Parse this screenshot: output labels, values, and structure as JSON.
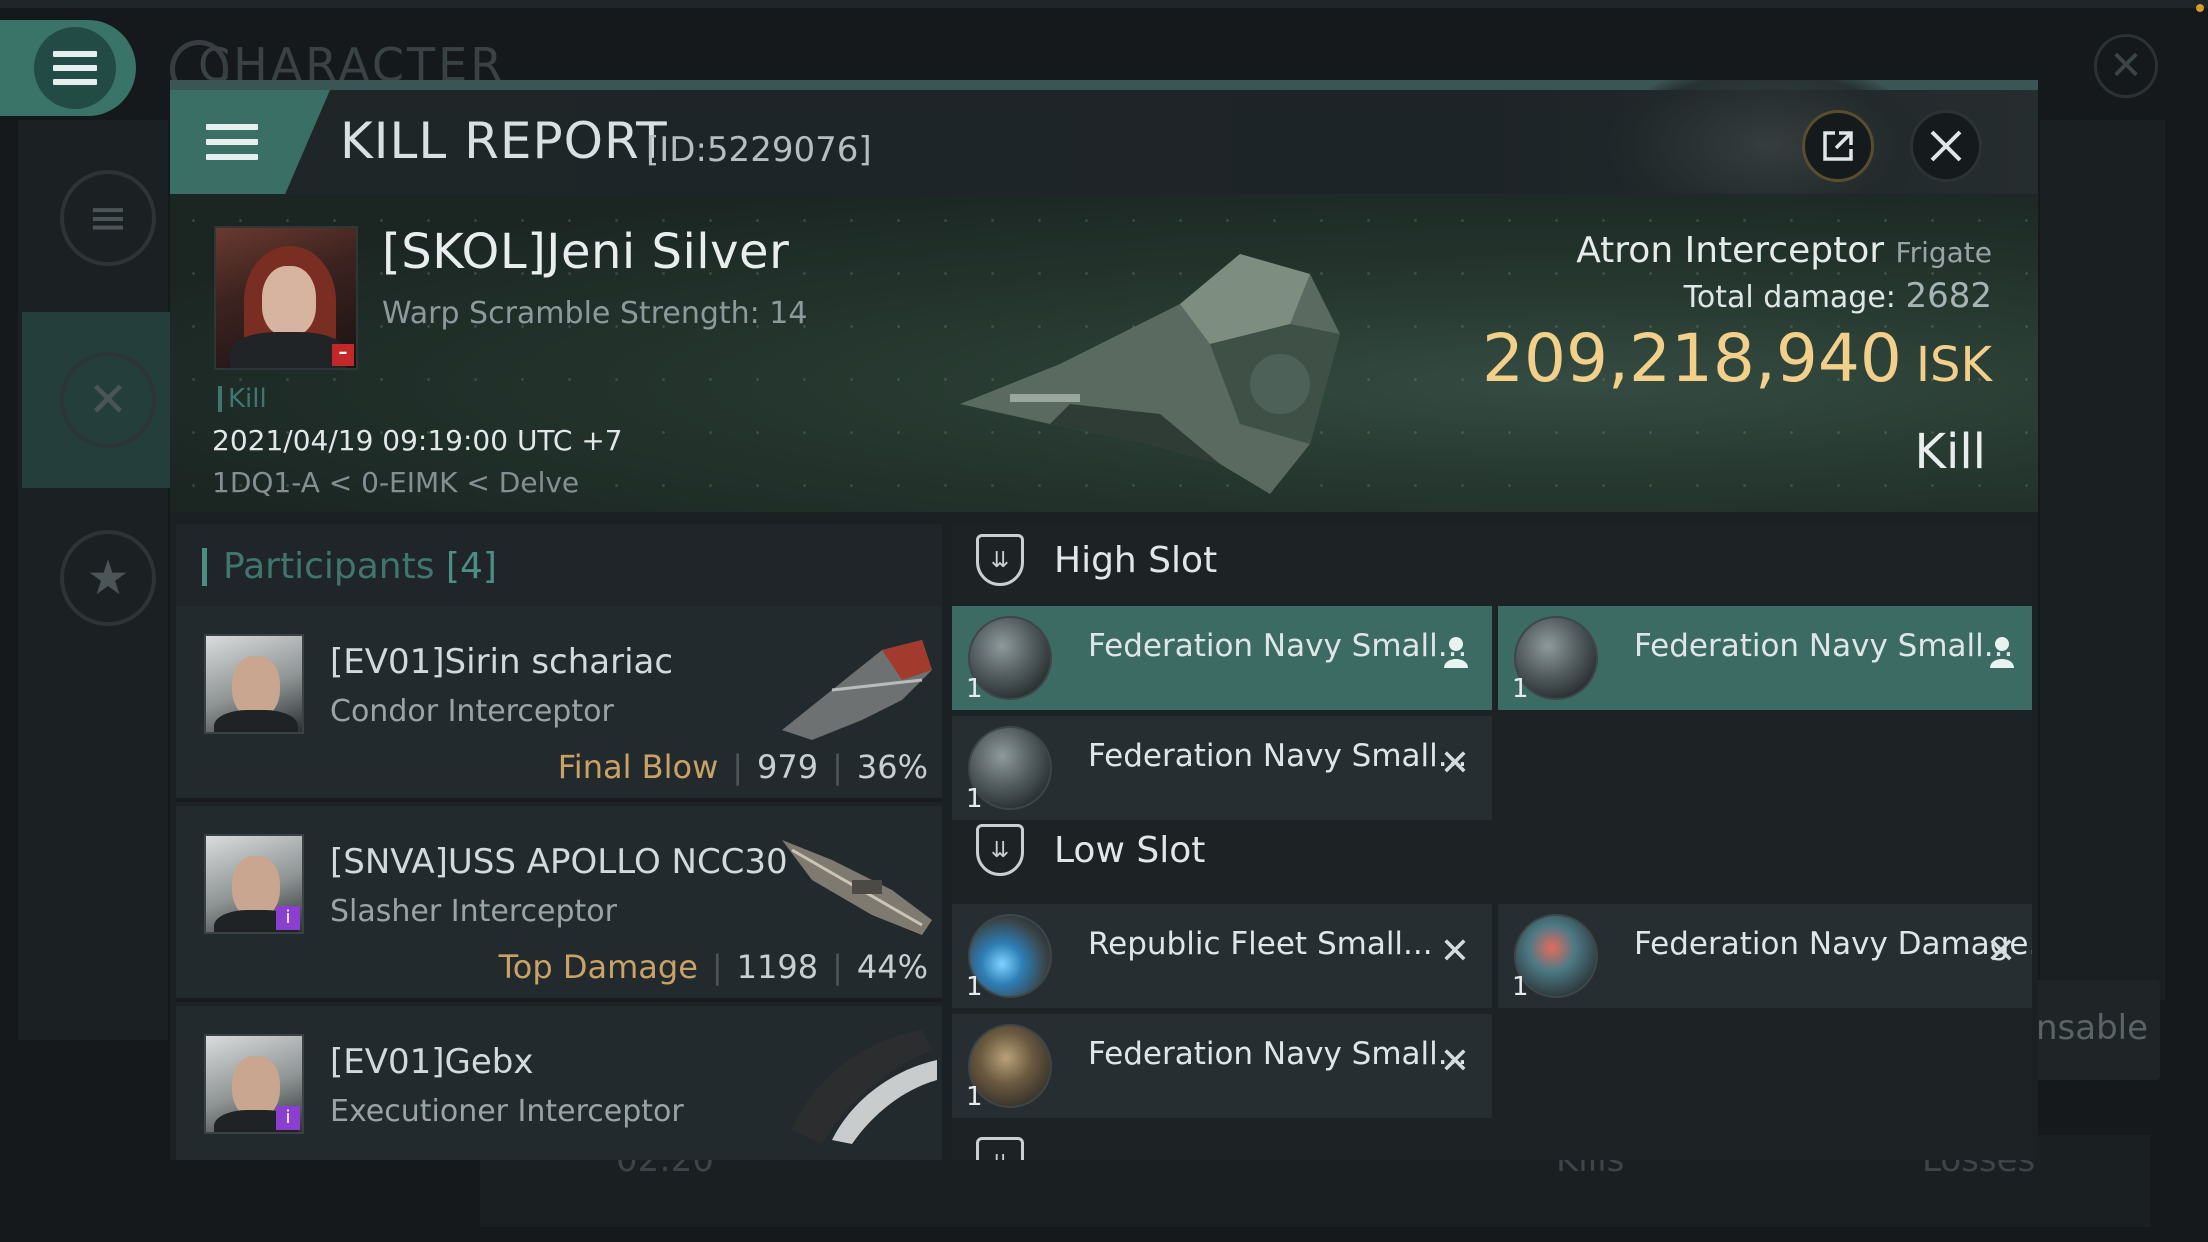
{
  "background": {
    "title": "CHARACTER",
    "bottom_left_value": "02:20",
    "bottom_kills": "Kills",
    "bottom_losses": "Losses",
    "right_button_partial": "nsable"
  },
  "header": {
    "title": "KILL REPORT",
    "id": "[ID:5229076]"
  },
  "victim": {
    "name": "[SKOL]Jeni Silver",
    "subtitle": "Warp Scramble Strength: 14",
    "tag": "Kill",
    "datetime": "2021/04/19 09:19:00 UTC +7",
    "location": "1DQ1-A < 0-EIMK < Delve",
    "ship": "Atron Interceptor",
    "ship_class": "Frigate",
    "total_damage_label": "Total damage:",
    "total_damage": "2682",
    "isk_value": "209,218,940",
    "isk_unit": "ISK",
    "result": "Kill"
  },
  "participants": {
    "title": "Participants",
    "count": "[4]",
    "rows": [
      {
        "name": "[EV01]Sirin schariac",
        "ship": "Condor Interceptor",
        "tag": "Final Blow",
        "damage": "979",
        "percent": "36%"
      },
      {
        "name": "[SNVA]USS APOLLO NCC30",
        "ship": "Slasher Interceptor",
        "tag": "Top Damage",
        "damage": "1198",
        "percent": "44%"
      },
      {
        "name": "[EV01]Gebx",
        "ship": "Executioner Interceptor",
        "tag": "",
        "damage": "",
        "percent": ""
      }
    ]
  },
  "fitting": {
    "high_slot": {
      "label": "High Slot",
      "modules": [
        {
          "name": "Federation Navy Small...",
          "qty": "1",
          "status": "dropped"
        },
        {
          "name": "Federation Navy Small...",
          "qty": "1",
          "status": "dropped"
        },
        {
          "name": "Federation Navy Small...",
          "qty": "1",
          "status": "destroyed"
        }
      ]
    },
    "low_slot": {
      "label": "Low Slot",
      "modules": [
        {
          "name": "Republic Fleet Small...",
          "qty": "1",
          "status": "destroyed"
        },
        {
          "name": "Federation Navy Damage...",
          "qty": "1",
          "status": "destroyed"
        },
        {
          "name": "Federation Navy Small...",
          "qty": "1",
          "status": "destroyed"
        }
      ]
    }
  },
  "colors": {
    "accent_teal": "#3c6b64",
    "isk_gold": "#f2d08a",
    "tag_gold": "#c9a266"
  }
}
